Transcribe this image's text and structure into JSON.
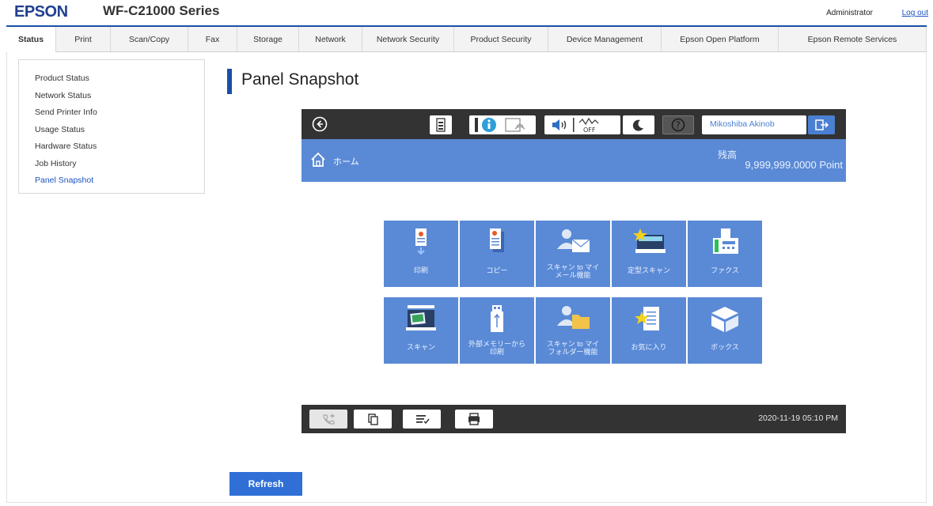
{
  "header": {
    "brand": "EPSON",
    "model": "WF-C21000 Series",
    "user": "Administrator",
    "logout": "Log out"
  },
  "tabs": [
    {
      "label": "Status",
      "active": true
    },
    {
      "label": "Print"
    },
    {
      "label": "Scan/Copy"
    },
    {
      "label": "Fax"
    },
    {
      "label": "Storage"
    },
    {
      "label": "Network"
    },
    {
      "label": "Network Security"
    },
    {
      "label": "Product Security"
    },
    {
      "label": "Device Management"
    },
    {
      "label": "Epson Open Platform"
    },
    {
      "label": "Epson Remote Services"
    }
  ],
  "sidebar": {
    "items": [
      {
        "label": "Product Status"
      },
      {
        "label": "Network Status"
      },
      {
        "label": "Send Printer Info"
      },
      {
        "label": "Usage Status"
      },
      {
        "label": "Hardware Status"
      },
      {
        "label": "Job History"
      },
      {
        "label": "Panel Snapshot",
        "active": true
      }
    ]
  },
  "main": {
    "title": "Panel Snapshot",
    "refresh_label": "Refresh"
  },
  "panel": {
    "topbar": {
      "user_name": "Mikoshiba Akinob",
      "sound_off_label": "OFF",
      "icons": [
        "back-icon",
        "ink-icon",
        "info-icon",
        "wifi-icon",
        "speaker-icon",
        "sound-wave-icon",
        "sleep-moon-icon",
        "help-icon",
        "logout-icon"
      ]
    },
    "home": {
      "label": "ホーム",
      "balance_label": "残高",
      "balance_value": "9,999,999.0000 Point"
    },
    "tiles": [
      {
        "label": "印刷",
        "icon": "print-icon"
      },
      {
        "label": "コピー",
        "icon": "copy-icon"
      },
      {
        "label": "スキャン to マイメール機能",
        "line1": "スキャン to マイ",
        "line2": "メール機能",
        "icon": "scan-to-mail-icon"
      },
      {
        "label": "定型スキャン",
        "icon": "preset-scan-icon"
      },
      {
        "label": "ファクス",
        "icon": "fax-icon"
      },
      {
        "label": "スキャン",
        "icon": "scanner-icon"
      },
      {
        "label": "外部メモリーから印刷",
        "line1": "外部メモリーから",
        "line2": "印刷",
        "icon": "usb-memory-icon"
      },
      {
        "label": "スキャン to マイフォルダー機能",
        "line1": "スキャン to マイ",
        "line2": "フォルダー機能",
        "icon": "scan-to-folder-icon"
      },
      {
        "label": "お気に入り",
        "icon": "favorites-icon"
      },
      {
        "label": "ボックス",
        "icon": "box-icon"
      }
    ],
    "bottombar": {
      "datetime": "2020-11-19 05:10 PM",
      "icons": [
        "fax-status-icon",
        "copy-status-icon",
        "job-list-icon",
        "printer-status-icon"
      ]
    }
  },
  "colors": {
    "brand": "#1f3f8f",
    "accent": "#1a4fa8",
    "panel_blue": "#5a8ad6",
    "panel_dark": "#333333",
    "link": "#1a55c2",
    "refresh": "#2f6fd6"
  }
}
